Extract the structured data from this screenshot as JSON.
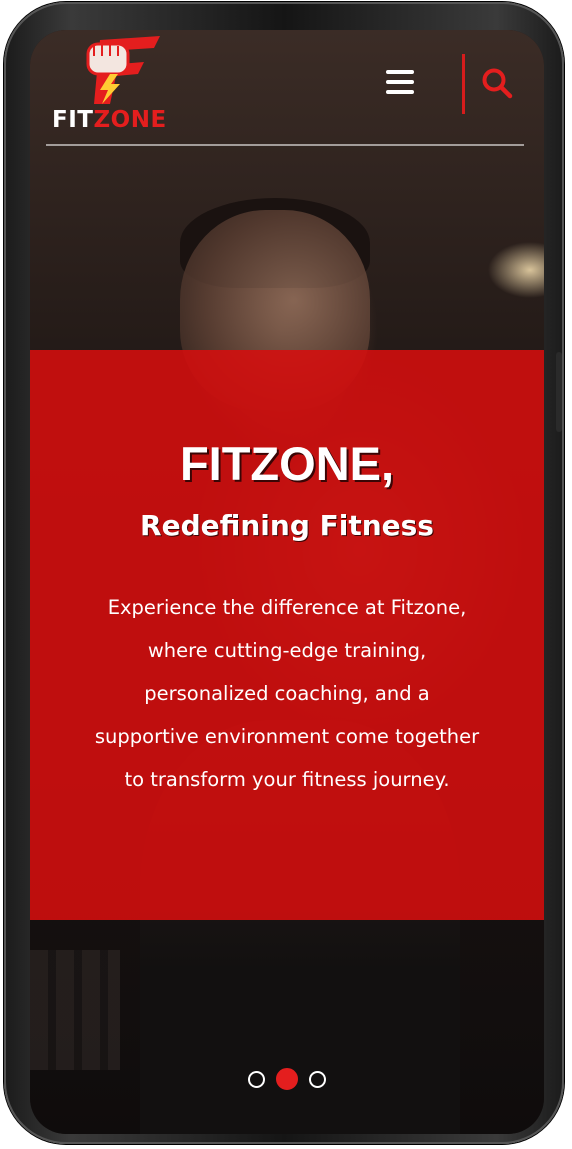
{
  "brand": {
    "name_part1": "FIT",
    "name_part2": "ZONE",
    "logo_icon": "fist-lightning-icon",
    "accent_color": "#e41e1e"
  },
  "header": {
    "menu_icon": "hamburger-menu-icon",
    "search_icon": "search-icon"
  },
  "hero": {
    "title": "FITZONE,",
    "subtitle": "Redefining Fitness",
    "description": "Experience the difference at Fitzone, where cutting-edge training, personalized coaching, and a supportive environment come together to transform your fitness journey.",
    "band_color": "#d60e0e"
  },
  "carousel": {
    "slide_count": 3,
    "active_index": 1
  }
}
